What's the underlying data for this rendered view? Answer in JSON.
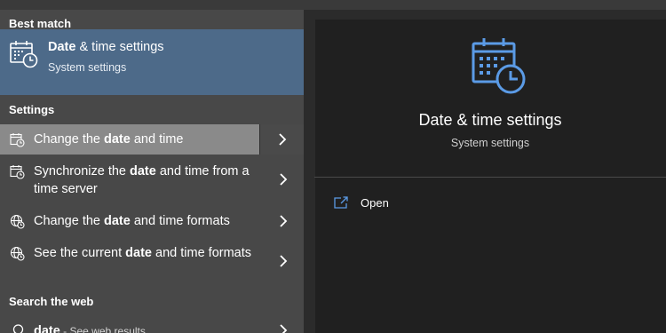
{
  "best_match": {
    "header": "Best match",
    "title_bold": "Date",
    "title_rest": " & time settings",
    "subtitle": "System settings"
  },
  "settings": {
    "header": "Settings",
    "items": [
      {
        "pre": "Change the ",
        "bold": "date",
        "post": " and time",
        "icon": "date-time-settings-icon",
        "selected": true
      },
      {
        "pre": "Synchronize the ",
        "bold": "date",
        "post": " and time from a time server",
        "icon": "date-time-settings-icon"
      },
      {
        "pre": "Change the ",
        "bold": "date",
        "post": " and time formats",
        "icon": "region-globe-icon"
      },
      {
        "pre": "See the current ",
        "bold": "date",
        "post": " and time formats",
        "icon": "region-globe-icon"
      }
    ]
  },
  "search_web": {
    "header": "Search the web",
    "item": {
      "bold": "date",
      "rest": " - See web results"
    }
  },
  "preview": {
    "title": "Date & time settings",
    "subtitle": "System settings",
    "actions": [
      {
        "label": "Open",
        "icon": "open-external-icon"
      }
    ]
  },
  "colors": {
    "accent": "#4d6a89",
    "icon_blue": "#5b9be6",
    "selected_row": "#8a8a8a"
  }
}
